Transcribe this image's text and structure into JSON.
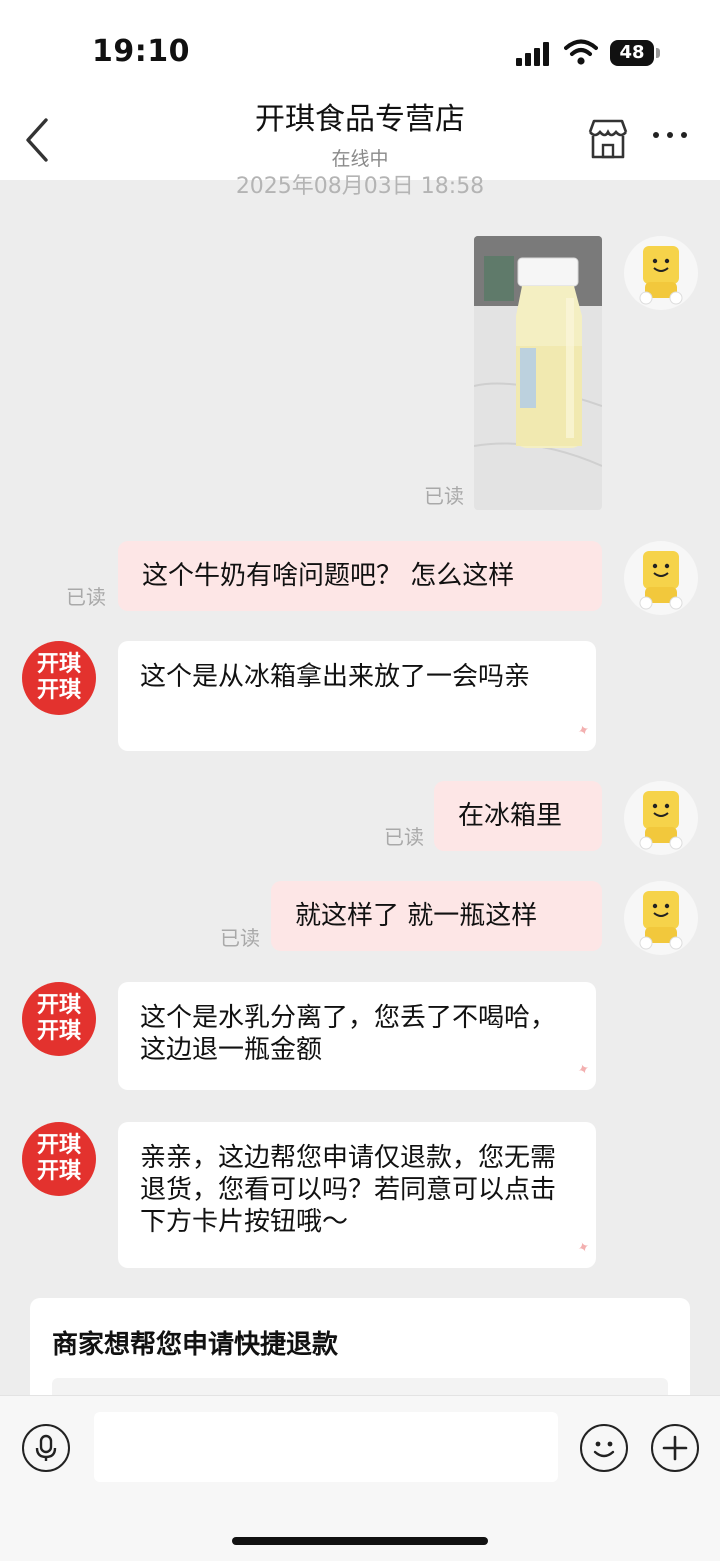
{
  "status_bar": {
    "time": "19:10",
    "battery": "48"
  },
  "nav": {
    "title": "开琪食品专营店",
    "status": "在线中"
  },
  "chat": {
    "timestamp": "2025年08月03日 18:58",
    "shop_avatar_text": "开琪\n开琪",
    "read_label": "已读",
    "messages": {
      "m1": "这个牛奶有啥问题吧？ 怎么这样",
      "m2": "这个是从冰箱拿出来放了一会吗亲",
      "m3": "在冰箱里",
      "m4": "就这样了 就一瓶这样",
      "m5": "这个是水乳分离了，您丢了不喝哈，这边退一瓶金额",
      "m6": "亲亲，这边帮您申请仅退款，您无需退货，您看可以吗？若同意可以点击下方卡片按钮哦～"
    }
  },
  "card": {
    "title": "商家想帮您申请快捷退款"
  },
  "icons": {
    "back": "chevron-left-icon",
    "shop": "store-icon",
    "more": "more-icon",
    "voice": "microphone-icon",
    "emoji": "emoji-icon",
    "plus": "plus-icon"
  }
}
